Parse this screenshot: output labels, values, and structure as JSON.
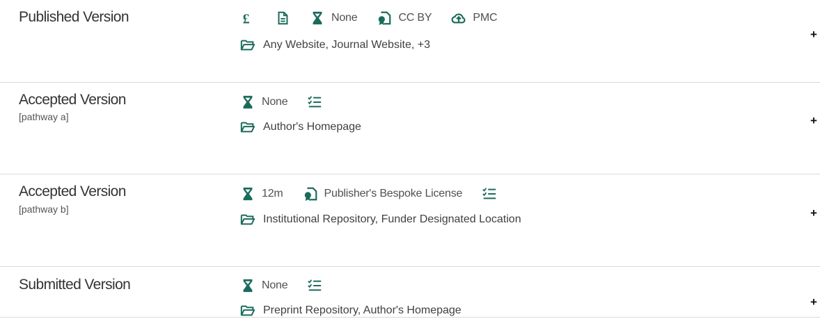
{
  "colors": {
    "accent": "#1b6b5b",
    "divider": "#d9d9d9",
    "text": "#404040"
  },
  "pathways": [
    {
      "title": "Published Version",
      "subtitle": "",
      "icons": [
        {
          "icon": "pound-icon",
          "label": ""
        },
        {
          "icon": "document-icon",
          "label": ""
        },
        {
          "icon": "hourglass-icon",
          "label": "None"
        },
        {
          "icon": "license-icon",
          "label": "CC BY"
        },
        {
          "icon": "cloud-upload-icon",
          "label": "PMC"
        }
      ],
      "locations": "Any Website, Journal Website, +3",
      "expand": "+"
    },
    {
      "title": "Accepted Version",
      "subtitle": "[pathway a]",
      "icons": [
        {
          "icon": "hourglass-icon",
          "label": "None"
        },
        {
          "icon": "conditions-list-icon",
          "label": ""
        }
      ],
      "locations": "Author's Homepage",
      "expand": "+"
    },
    {
      "title": "Accepted Version",
      "subtitle": "[pathway b]",
      "icons": [
        {
          "icon": "hourglass-icon",
          "label": "12m"
        },
        {
          "icon": "license-icon",
          "label": "Publisher's Bespoke License"
        },
        {
          "icon": "conditions-list-icon",
          "label": ""
        }
      ],
      "locations": "Institutional Repository, Funder Designated Location",
      "expand": "+"
    },
    {
      "title": "Submitted Version",
      "subtitle": "",
      "icons": [
        {
          "icon": "hourglass-icon",
          "label": "None"
        },
        {
          "icon": "conditions-list-icon",
          "label": ""
        }
      ],
      "locations": "Preprint Repository, Author's Homepage",
      "expand": "+"
    }
  ]
}
